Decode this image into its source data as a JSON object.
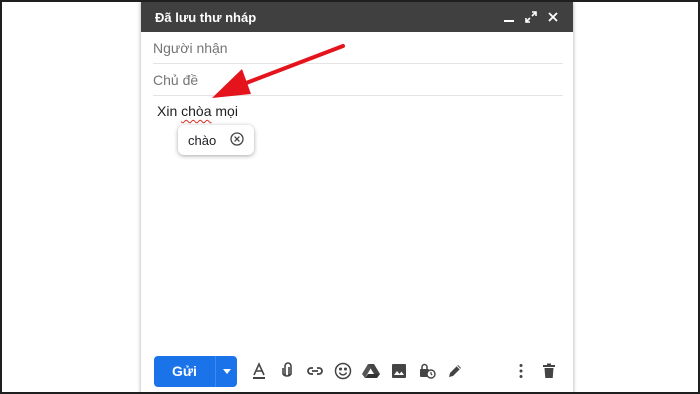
{
  "compose": {
    "title": "Đã lưu thư nháp",
    "to_placeholder": "Người nhận",
    "subject_placeholder": "Chủ đề",
    "body": {
      "before": "Xin ",
      "misspelled": "chòa",
      "after": " mọi"
    },
    "suggestion": "chào",
    "send_label": "Gửi"
  },
  "icons": {
    "titlebar": [
      "minimize-icon",
      "fullscreen-icon",
      "close-icon"
    ],
    "toolbar": [
      "format-text-icon",
      "attach-icon",
      "link-icon",
      "emoji-icon",
      "drive-icon",
      "photo-icon",
      "confidential-icon",
      "signature-icon"
    ],
    "right": [
      "more-options-icon",
      "trash-icon"
    ]
  },
  "colors": {
    "accent": "#1a73e8",
    "titlebar": "#404040",
    "annotation_arrow": "#e5131c",
    "spellcheck_underline": "#d93025"
  }
}
